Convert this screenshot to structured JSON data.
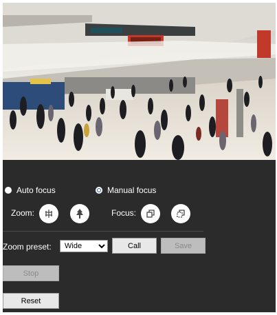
{
  "focus_mode": {
    "auto_label": "Auto focus",
    "manual_label": "Manual focus",
    "selected": "manual"
  },
  "zoom": {
    "label": "Zoom:",
    "wide_icon": "zoom-wide-icon",
    "tele_icon": "zoom-tele-icon"
  },
  "focus": {
    "label": "Focus:",
    "near_icon": "focus-near-icon",
    "far_icon": "focus-far-icon"
  },
  "zoom_preset": {
    "label": "Zoom preset:",
    "selected": "Wide",
    "call_label": "Call",
    "save_label": "Save"
  },
  "stop_label": "Stop",
  "reset_label": "Reset",
  "colors": {
    "panel_bg": "#2b2b2b",
    "radio_selected": "#1e5fa8"
  }
}
